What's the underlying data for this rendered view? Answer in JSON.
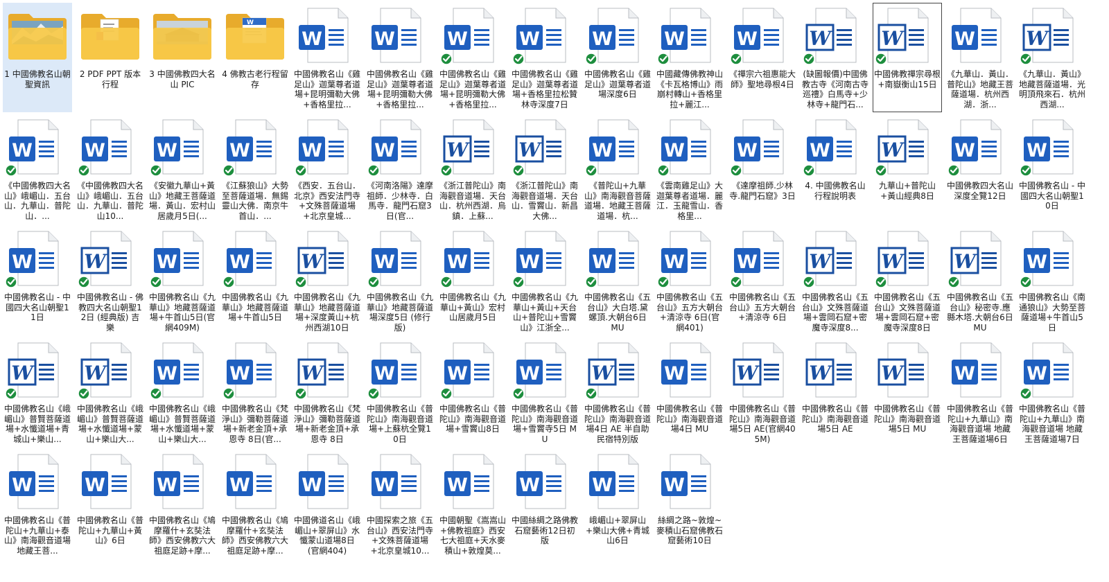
{
  "colors": {
    "word_blue": "#1f5fbf",
    "word_blue_dark": "#1a4fa0",
    "sync_green": "#1e8e3e",
    "folder_yellow": "#f7c948",
    "selection_blue": "#dce9f8"
  },
  "items": [
    {
      "type": "folder",
      "thumb": "mountain",
      "label": "1 中國佛教名山朝聖資訊",
      "selected": true
    },
    {
      "type": "folder",
      "thumb": "pdf",
      "label": "2 PDF PPT 版本行程"
    },
    {
      "type": "folder",
      "thumb": "building",
      "label": "3 中國佛教四大名山 PIC"
    },
    {
      "type": "folder",
      "thumb": "doc",
      "label": "4 佛教古老行程留存"
    },
    {
      "type": "word",
      "style": "modern",
      "synced": false,
      "label": "中國佛教名山《雞足山》迦葉尊者道場+昆明彌勒大佛+香格里拉..."
    },
    {
      "type": "word",
      "style": "modern",
      "synced": false,
      "label": "中國佛教名山《雞足山》迦葉尊者道場+昆明彌勒大佛+香格里拉..."
    },
    {
      "type": "word",
      "style": "modern",
      "synced": true,
      "label": "中國佛教名山《雞足山》迦葉尊者道場+昆明彌勒大佛+香格里拉..."
    },
    {
      "type": "word",
      "style": "modern",
      "synced": true,
      "label": "中國佛教名山《雞足山》迦葉尊者道場+香格里拉松贊林寺深度7日"
    },
    {
      "type": "word",
      "style": "modern",
      "synced": true,
      "label": "中國佛教名山《雞足山》迦葉尊者道場深度6日"
    },
    {
      "type": "word",
      "style": "modern",
      "synced": true,
      "label": "中國藏傳佛教神山《卡瓦格博山》雨崩村轉山+香格里拉+麗江..."
    },
    {
      "type": "word",
      "style": "modern",
      "synced": true,
      "label": "《禪宗六祖惠能大師》聖地尋根4日"
    },
    {
      "type": "word",
      "style": "classic",
      "synced": true,
      "label": "(缺圖報價)中國佛教古寺《河南古寺巡禮》白馬寺+少林寺+龍門石..."
    },
    {
      "type": "word",
      "style": "classic",
      "synced": true,
      "label": "中國佛教禪宗尋根+南嶽衡山15日",
      "focused": true
    },
    {
      "type": "word",
      "style": "modern",
      "synced": false,
      "label": "《九華山．黃山．普陀山》地藏王菩薩道場．杭州西湖．浙..."
    },
    {
      "type": "word",
      "style": "classic",
      "synced": true,
      "label": "《九華山．黃山》地藏菩薩道場．光明頂飛來石．杭州西湖..."
    },
    {
      "type": "word",
      "style": "modern",
      "synced": true,
      "label": "《中國佛教四大名山》峨嵋山．五台山．九華山．普陀山．..."
    },
    {
      "type": "word",
      "style": "modern",
      "synced": true,
      "label": "《中國佛教四大名山》峨嵋山．五台山．九華山．普陀山10..."
    },
    {
      "type": "word",
      "style": "modern",
      "synced": true,
      "label": "《安徽九華山+黃山》地藏王菩薩道場．黃山．宏村山居歲月5日(..."
    },
    {
      "type": "word",
      "style": "modern",
      "synced": true,
      "label": "《江蘇狼山》大勢至菩薩道場．無錫靈山大佛．南京牛首山．..."
    },
    {
      "type": "word",
      "style": "modern",
      "synced": true,
      "label": "《西安．五台山．北京》西安法門寺+文殊菩薩道場+北京皇城..."
    },
    {
      "type": "word",
      "style": "modern",
      "synced": true,
      "label": "《河南洛陽》達摩祖師．少林寺．白馬寺．龍門石窟3日(官..."
    },
    {
      "type": "word",
      "style": "classic",
      "synced": true,
      "label": "《浙江普陀山》南海觀音道場．天台山．杭州西湖．烏鎮．上蘇..."
    },
    {
      "type": "word",
      "style": "classic",
      "synced": true,
      "label": "《浙江普陀山》南海觀音道場．天台山．雪竇山．新昌大佛..."
    },
    {
      "type": "word",
      "style": "modern",
      "synced": true,
      "label": "《普陀山+九華山》南海觀音菩薩道場．地藏王菩薩道場．杭..."
    },
    {
      "type": "word",
      "style": "modern",
      "synced": true,
      "label": "《雲南雞足山》大迦葉尊者道場．麗江．玉龍雪山．香格里..."
    },
    {
      "type": "word",
      "style": "modern",
      "synced": true,
      "label": "《達摩祖師.少林寺.龍門石窟》3日"
    },
    {
      "type": "word",
      "style": "modern",
      "synced": true,
      "label": "4. 中國佛教名山行程說明表"
    },
    {
      "type": "word",
      "style": "classic",
      "synced": true,
      "label": "九華山+普陀山+黃山經典8日"
    },
    {
      "type": "word",
      "style": "modern",
      "synced": true,
      "label": "中國佛教四大名山深度全覽12日"
    },
    {
      "type": "word",
      "style": "modern",
      "synced": true,
      "label": "中國佛教名山 - 中國四大名山朝聖10日"
    },
    {
      "type": "word",
      "style": "modern",
      "synced": true,
      "label": "中國佛教名山 - 中國四大名山朝聖11日"
    },
    {
      "type": "word",
      "style": "classic",
      "synced": true,
      "label": "中國佛教名山 - 佛教四大名山朝聖12日 (經典版) 吉樂"
    },
    {
      "type": "word",
      "style": "modern",
      "synced": true,
      "label": "中國佛教名山《九華山》地藏菩薩道場+牛首山5日(官網409M)"
    },
    {
      "type": "word",
      "style": "modern",
      "synced": true,
      "label": "中國佛教名山《九華山》地藏菩薩道場+牛首山5日"
    },
    {
      "type": "word",
      "style": "classic",
      "synced": true,
      "label": "中國佛教名山《九華山》地藏菩薩道場+深度黃山+杭州西湖10日"
    },
    {
      "type": "word",
      "style": "modern",
      "synced": true,
      "label": "中國佛教名山《九華山》地藏菩薩道場深度5日 (修行版)"
    },
    {
      "type": "word",
      "style": "modern",
      "synced": true,
      "label": "中國佛教名山《九華山+黃山》宏村山居歲月5日"
    },
    {
      "type": "word",
      "style": "modern",
      "synced": true,
      "label": "中國佛教名山《九華山+黃山+天台山+普陀山+雪竇山》江浙全..."
    },
    {
      "type": "word",
      "style": "modern",
      "synced": true,
      "label": "中國佛教名山《五台山》大白塔.黛螺頂.大朝台6日 MU"
    },
    {
      "type": "word",
      "style": "modern",
      "synced": true,
      "label": "中國佛教名山《五台山》五方大朝台+清涼寺 6日(官網401)"
    },
    {
      "type": "word",
      "style": "modern",
      "synced": true,
      "label": "中國佛教名山《五台山》五方大朝台+清涼寺 6日"
    },
    {
      "type": "word",
      "style": "classic",
      "synced": true,
      "label": "中國佛教名山《五台山》文殊菩薩道場+雲岡石窟+密魔寺深度8..."
    },
    {
      "type": "word",
      "style": "classic",
      "synced": true,
      "label": "中國佛教名山《五台山》文殊菩薩道場+雲岡石窟+密魔寺深度8日"
    },
    {
      "type": "word",
      "style": "classic",
      "synced": true,
      "label": "中國佛教名山《五台山》秘密寺.應縣木塔.大朝台6日 MU"
    },
    {
      "type": "word",
      "style": "modern",
      "synced": true,
      "label": "中國佛教名山《南通狼山》大勢至菩薩道場+牛首山5日"
    },
    {
      "type": "word",
      "style": "classic",
      "synced": true,
      "label": "中國佛教名山《峨嵋山》普賢菩薩道場+水懺道場+青城山+樂山..."
    },
    {
      "type": "word",
      "style": "classic",
      "synced": true,
      "label": "中國佛教名山《峨嵋山》普賢菩薩道場+水懺道場+蒙山+樂山大..."
    },
    {
      "type": "word",
      "style": "modern",
      "synced": true,
      "label": "中國佛教名山《峨嵋山》普賢菩薩道場+水懺道場+蒙山+樂山大..."
    },
    {
      "type": "word",
      "style": "modern",
      "synced": true,
      "label": "中國佛教名山《梵淨山》彌勒菩薩道場+新老金頂+承恩寺 8日(官..."
    },
    {
      "type": "word",
      "style": "classic",
      "synced": true,
      "label": "中國佛教名山《梵淨山》彌勒菩薩道場+新老金頂+承恩寺 8日"
    },
    {
      "type": "word",
      "style": "modern",
      "synced": true,
      "label": "中國佛教名山《普陀山》南海觀音道場+上蘇杭全覽10日"
    },
    {
      "type": "word",
      "style": "modern",
      "synced": true,
      "label": "中國佛教名山《普陀山》南海觀音道場+雪竇山8日"
    },
    {
      "type": "word",
      "style": "modern",
      "synced": true,
      "label": "中國佛教名山《普陀山》南海觀音道場+雪竇寺5日 MU"
    },
    {
      "type": "word",
      "style": "classic",
      "synced": true,
      "label": "中國佛教名山《普陀山》南海觀音道場4日 AE 半自助民宿特別版"
    },
    {
      "type": "word",
      "style": "modern",
      "synced": false,
      "label": "中國佛教名山《普陀山》南海觀音道場4日 MU"
    },
    {
      "type": "word",
      "style": "classic",
      "synced": false,
      "label": "中國佛教名山《普陀山》南海觀音道場5日 AE(官網405M)"
    },
    {
      "type": "word",
      "style": "classic",
      "synced": false,
      "label": "中國佛教名山《普陀山》南海觀音道場5日 AE"
    },
    {
      "type": "word",
      "style": "classic",
      "synced": false,
      "label": "中國佛教名山《普陀山》南海觀音道場5日 MU"
    },
    {
      "type": "word",
      "style": "modern",
      "synced": false,
      "label": "中國佛教名山《普陀山+九華山》南海觀音道場 地藏王菩薩道場6日"
    },
    {
      "type": "word",
      "style": "modern",
      "synced": true,
      "label": "中國佛教名山《普陀山+九華山》南海觀音道場 地藏王菩薩道場7日"
    },
    {
      "type": "word",
      "style": "modern",
      "synced": false,
      "label": "中國佛教名山《普陀山+九華山+泰山》南海觀音道場 地藏王菩..."
    },
    {
      "type": "word",
      "style": "modern",
      "synced": false,
      "label": "中國佛教名山《普陀山+九華山+黃山》6日"
    },
    {
      "type": "word",
      "style": "modern",
      "synced": false,
      "label": "中國佛教名山《鳩摩羅什+玄奘法師》西安佛教六大祖庭足跡+摩..."
    },
    {
      "type": "word",
      "style": "modern",
      "synced": false,
      "label": "中國佛教名山《鳩摩羅什+玄奘法師》西安佛教六大祖庭足跡+摩..."
    },
    {
      "type": "word",
      "style": "modern",
      "synced": false,
      "label": "中國佛道名山《峨嵋山+翠屏山》水懺蒙山道場8日(官網404)"
    },
    {
      "type": "word",
      "style": "modern",
      "synced": false,
      "label": "中國探索之旅《五台山》西安法門寺+文殊菩薩道場+北京皇城10..."
    },
    {
      "type": "word",
      "style": "modern",
      "synced": false,
      "label": "中國朝聖《嵩嵩山+佛教祖庭》西安七大祖庭+天水麥積山+敦煌莫..."
    },
    {
      "type": "word",
      "style": "modern",
      "synced": false,
      "label": "中國絲綢之路佛教石窟藝術12日初版"
    },
    {
      "type": "word",
      "style": "modern",
      "synced": false,
      "label": "峨嵋山+翠屏山+樂山大佛+青城山6日"
    },
    {
      "type": "word",
      "style": "modern",
      "synced": false,
      "label": "絲綢之路~敦煌~麥積山石窟佛教石窟藝術10日"
    }
  ]
}
